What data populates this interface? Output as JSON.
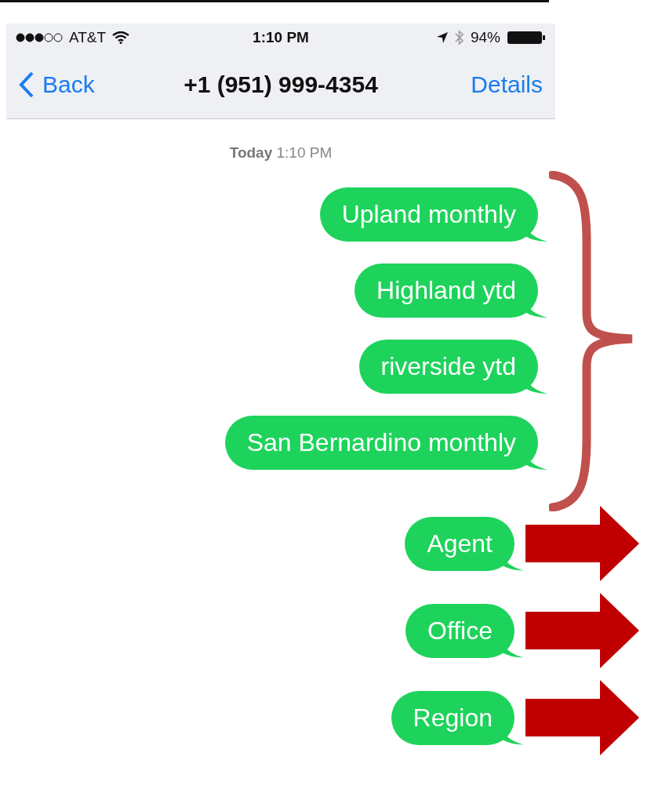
{
  "status_bar": {
    "carrier": "AT&T",
    "time": "1:10 PM",
    "battery": "94%"
  },
  "nav_bar": {
    "back": "Back",
    "title": "+1 (951) 999-4354",
    "action": "Details"
  },
  "timestamp": "**Today** 1:10 PM",
  "messages": [
    {
      "text": "Upland monthly",
      "kind": "brace"
    },
    {
      "text": "Highland ytd",
      "kind": "brace"
    },
    {
      "text": "riverside ytd",
      "kind": "brace"
    },
    {
      "text": "San Bernardino monthly",
      "kind": "brace"
    },
    {
      "text": "Agent",
      "kind": "arrow"
    },
    {
      "text": "Office",
      "kind": "arrow"
    },
    {
      "text": "Region",
      "kind": "arrow"
    }
  ]
}
